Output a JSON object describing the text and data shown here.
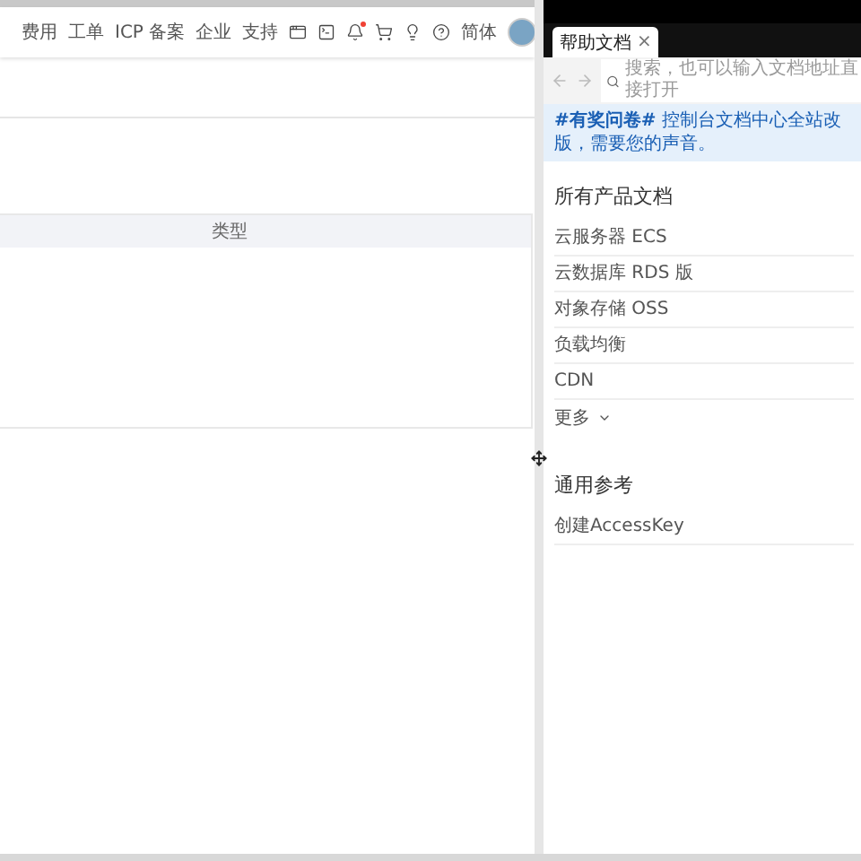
{
  "console": {
    "nav": [
      {
        "kind": "text",
        "label": "费用"
      },
      {
        "kind": "text",
        "label": "工单"
      },
      {
        "kind": "text",
        "label": "ICP 备案"
      },
      {
        "kind": "text",
        "label": "企业"
      },
      {
        "kind": "text",
        "label": "支持"
      },
      {
        "kind": "icon",
        "dot": false
      },
      {
        "kind": "icon",
        "dot": false
      },
      {
        "kind": "icon",
        "dot": true
      },
      {
        "kind": "icon",
        "dot": false
      },
      {
        "kind": "icon",
        "dot": false
      },
      {
        "kind": "icon",
        "dot": false
      },
      {
        "kind": "text",
        "label": "简体"
      },
      {
        "kind": "avatar"
      }
    ],
    "table": {
      "columns": [
        {
          "label": "类型"
        }
      ]
    }
  },
  "help_panel": {
    "tab": {
      "label": "帮助文档",
      "selected": true,
      "close": "×"
    },
    "search": {
      "placeholder": "搜索，也可以输入文档地址直接打开"
    },
    "banner": "**#有奖问卷#** 控制台文档中心全站改版，需要您的声音。",
    "sections": [
      {
        "title": "所有产品文档",
        "items": [
          {
            "label": "云服务器 ECS"
          },
          {
            "label": "云数据库 RDS 版"
          },
          {
            "label": "对象存储 OSS"
          },
          {
            "label": "负载均衡"
          },
          {
            "label": "CDN"
          }
        ],
        "more": {
          "label": "更多",
          "expanded": false
        }
      },
      {
        "title": "通用参考",
        "items": [
          {
            "label": "创建AccessKey"
          }
        ]
      }
    ]
  }
}
